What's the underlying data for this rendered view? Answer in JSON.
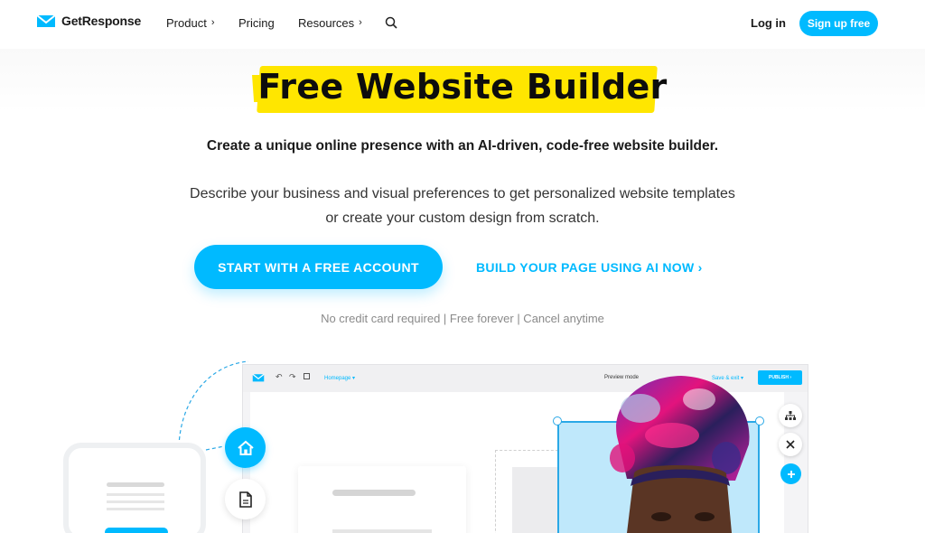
{
  "brand": {
    "name": "GetResponse",
    "accent": "#00baff",
    "highlight": "#ffe600"
  },
  "nav": {
    "items": [
      {
        "label": "Product",
        "has_chevron": true
      },
      {
        "label": "Pricing",
        "has_chevron": false
      },
      {
        "label": "Resources",
        "has_chevron": true
      }
    ],
    "login": "Log in",
    "signup": "Sign up free"
  },
  "hero": {
    "title": "Free Website Builder",
    "subtitle": "Create a unique online presence with an AI-driven, code-free website builder.",
    "desc_line1": "Describe your business and visual preferences to get personalized website templates",
    "desc_line2": "or create your custom design from scratch.",
    "cta_primary": "START WITH A FREE ACCOUNT",
    "cta_secondary": "BUILD YOUR PAGE USING AI NOW ›",
    "note": "No credit card required | Free forever | Cancel anytime"
  },
  "editor": {
    "page_selector": "Homepage ▾",
    "preview": "Preview mode",
    "save": "Save & exit ▾",
    "publish": "PUBLISH ›"
  },
  "icons": [
    "logo-envelope-icon",
    "search-icon",
    "chevron-right-icon",
    "home-icon",
    "page-icon",
    "undo-icon",
    "redo-icon",
    "save-icon",
    "sitemap-icon",
    "close-icon",
    "plus-icon"
  ]
}
